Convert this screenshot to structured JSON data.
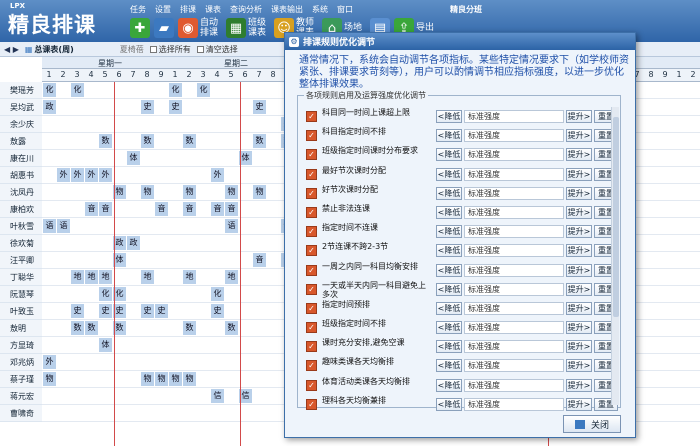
{
  "app": {
    "logo_small": "LPX",
    "logo": "精良排课",
    "name": "精良分班"
  },
  "menu": [
    "任务",
    "设置",
    "排课",
    "课表",
    "查询分析",
    "课表输出",
    "系统",
    "窗口"
  ],
  "toolbar": [
    {
      "label": "",
      "icon": "add-icon",
      "color": "#3aa63a"
    },
    {
      "label": "",
      "icon": "folder-icon",
      "color": "#3c79c0"
    },
    {
      "label": "自动排课",
      "icon": "palette-icon",
      "color": "#e05a30"
    },
    {
      "label": "班级课表",
      "icon": "table-icon",
      "color": "#2f7d2f"
    },
    {
      "label": "教师课表",
      "icon": "teacher-icon",
      "color": "#d8a020"
    },
    {
      "label": "场地",
      "icon": "room-icon",
      "color": "#3b9a5a"
    },
    {
      "label": "",
      "icon": "doc-icon",
      "color": "#5a8fd0"
    },
    {
      "label": "导出",
      "icon": "export-icon",
      "color": "#3aa63a"
    }
  ],
  "subbar": {
    "tab": "总课表(周)",
    "tag": "夏椅蓓",
    "check1": "选择所有",
    "check2": "清空选择"
  },
  "days": [
    "星期一",
    "星期二"
  ],
  "periods_visible": [
    "1",
    "2",
    "3",
    "4",
    "5",
    "6",
    "7",
    "8",
    "9",
    "1",
    "2",
    "3",
    "4",
    "5",
    "6",
    "7",
    "8",
    "9",
    "1",
    "2",
    "3",
    "4",
    "5",
    "6",
    "7",
    "8",
    "9"
  ],
  "teachers": [
    "樊瑶芳",
    "吴均武",
    "余少庆",
    "敖露",
    "康在川",
    "胡惠书",
    "沈凤丹",
    "康柏欢",
    "叶秋雪",
    "徐欢菊",
    "汪平卿",
    "丁聪华",
    "阮慧琴",
    "叶致玉",
    "敖明",
    "方显琦",
    "邓兆炳",
    "蔡子瑾",
    "蒋元宏",
    "曹啸奇"
  ],
  "cells": [
    [
      [
        "化",
        0
      ],
      [
        "化",
        2
      ],
      [
        "化",
        9
      ],
      [
        "化",
        11
      ],
      [
        "生",
        32
      ],
      [
        "生",
        34
      ]
    ],
    [
      [
        "政",
        0
      ],
      [
        "史",
        7
      ],
      [
        "史",
        9
      ],
      [
        "史",
        15
      ],
      [
        "政",
        35
      ]
    ],
    [
      [
        "美",
        17
      ]
    ],
    [
      [
        "数",
        4
      ],
      [
        "数",
        7
      ],
      [
        "数",
        10
      ],
      [
        "数",
        15
      ],
      [
        "数",
        17
      ]
    ],
    [
      [
        "体",
        6
      ],
      [
        "体",
        14
      ]
    ],
    [
      [
        "外",
        1
      ],
      [
        "外",
        2
      ],
      [
        "外",
        3
      ],
      [
        "外",
        4
      ],
      [
        "外",
        12
      ]
    ],
    [
      [
        "物",
        5
      ],
      [
        "物",
        7
      ],
      [
        "物",
        10
      ],
      [
        "物",
        13
      ],
      [
        "物",
        15
      ]
    ],
    [
      [
        "音",
        3
      ],
      [
        "音",
        4
      ],
      [
        "音",
        8
      ],
      [
        "音",
        10
      ],
      [
        "音",
        12
      ],
      [
        "音",
        13
      ],
      [
        "化",
        35
      ]
    ],
    [
      [
        "语",
        0
      ],
      [
        "语",
        1
      ],
      [
        "语",
        13
      ],
      [
        "语",
        17
      ],
      [
        "政",
        31
      ],
      [
        "政",
        33
      ]
    ],
    [
      [
        "政",
        5
      ],
      [
        "政",
        6
      ],
      [
        "政",
        32
      ],
      [
        "政",
        33
      ],
      [
        "政",
        34
      ]
    ],
    [
      [
        "体",
        5
      ],
      [
        "音",
        15
      ],
      [
        "音",
        17
      ]
    ],
    [
      [
        "地",
        2
      ],
      [
        "地",
        3
      ],
      [
        "地",
        4
      ],
      [
        "地",
        7
      ],
      [
        "地",
        10
      ],
      [
        "地",
        13
      ],
      [
        "化",
        34
      ]
    ],
    [
      [
        "化",
        4
      ],
      [
        "化",
        5
      ],
      [
        "化",
        12
      ]
    ],
    [
      [
        "史",
        2
      ],
      [
        "史",
        4
      ],
      [
        "史",
        5
      ],
      [
        "史",
        7
      ],
      [
        "史",
        8
      ],
      [
        "史",
        12
      ]
    ],
    [
      [
        "数",
        2
      ],
      [
        "数",
        3
      ],
      [
        "数",
        5
      ],
      [
        "数",
        10
      ],
      [
        "数",
        13
      ]
    ],
    [
      [
        "体",
        4
      ]
    ],
    [
      [
        "外",
        0
      ],
      [
        "外",
        27
      ],
      [
        "外",
        30
      ]
    ],
    [
      [
        "物",
        0
      ],
      [
        "物",
        7
      ],
      [
        "物",
        8
      ],
      [
        "物",
        9
      ],
      [
        "物",
        10
      ],
      [
        "物",
        35
      ]
    ],
    [
      [
        "信",
        12
      ],
      [
        "信",
        14
      ]
    ],
    [
      [
        "语",
        34
      ]
    ]
  ],
  "dialog": {
    "title": "排课规则优化调节",
    "desc": "通常情况下，系统会自动调节各项指标。某些特定情况要求下（如学校师资紧张、排课要求苛刻等），用户可以酌情调节相应指标强度，以进一步优化整体排课效果。",
    "group_label": "各项规则启用及运算强度优化调节",
    "down_label": "<降低",
    "up_label": "提升>",
    "reset_label": "重置",
    "level_text": "标准强度",
    "close_label": "关闭",
    "rules": [
      "科目同一时间上课超上限",
      "科目指定时间不排",
      "班级指定时间课时分布要求",
      "最好节次课时分配",
      "好节次课时分配",
      "禁止非法连课",
      "指定时间不连课",
      "2节连课不跨2-3节",
      "一周之内同一科目均衡安排",
      "一天或半天内同一科目避免上多次",
      "指定时间预排",
      "班级指定时间不排",
      "课时充分安排,避免空课",
      "趣味类课各天均衡排",
      "体育活动类课各天均衡排",
      "理科各天均衡兼排"
    ]
  }
}
